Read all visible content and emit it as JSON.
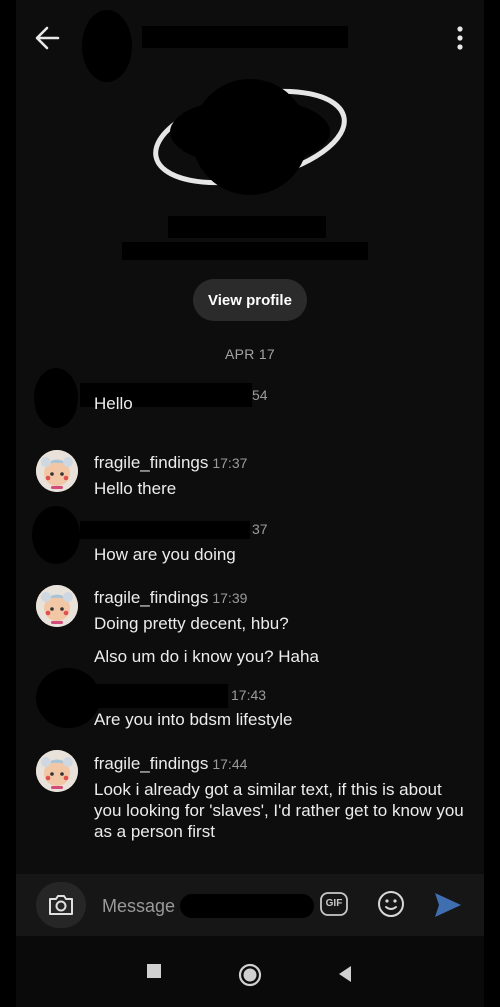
{
  "header": {
    "back_icon": "arrow-back-icon",
    "menu_icon": "more-vertical-icon"
  },
  "profile": {
    "view_profile_label": "View profile"
  },
  "thread": {
    "date_label": "APR 17",
    "messages": [
      {
        "sender": "",
        "time": "54",
        "lines": [
          "Hello"
        ]
      },
      {
        "sender": "fragile_findings",
        "time": "17:37",
        "lines": [
          "Hello there"
        ]
      },
      {
        "sender": "",
        "time": "37",
        "lines": [
          "How are you doing"
        ]
      },
      {
        "sender": "fragile_findings",
        "time": "17:39",
        "lines": [
          "Doing pretty decent, hbu?",
          "Also um do i know you? Haha"
        ]
      },
      {
        "sender": "",
        "time": "17:43",
        "lines": [
          "Are you into bdsm lifestyle"
        ]
      },
      {
        "sender": "fragile_findings",
        "time": "17:44",
        "lines": [
          "Look i already got a similar text, if this is about you looking for 'slaves', I'd rather get to know you as a person first"
        ]
      }
    ]
  },
  "composer": {
    "placeholder": "Message",
    "camera_icon": "camera-icon",
    "gif_label": "GIF",
    "emoji_icon": "emoji-icon",
    "send_icon": "send-icon"
  },
  "nav": {
    "recents_icon": "square-icon",
    "home_icon": "circle-home-icon",
    "back_icon": "triangle-back-icon"
  }
}
